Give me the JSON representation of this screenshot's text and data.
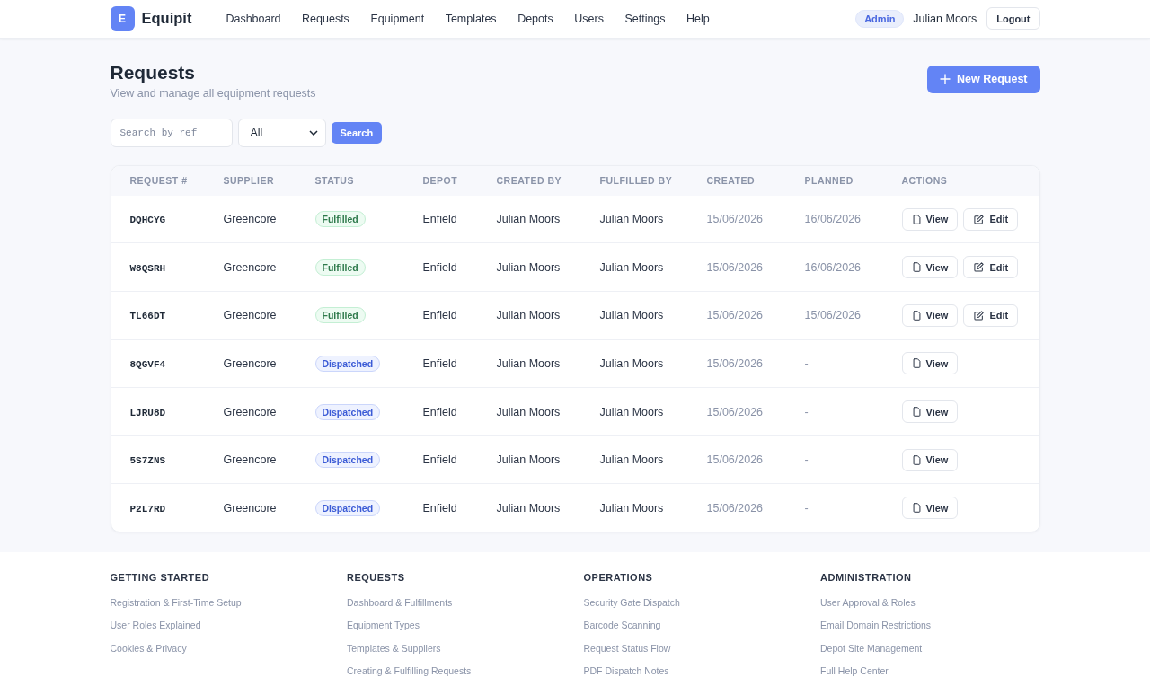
{
  "header": {
    "logo": {
      "mark": "E",
      "name": "Equipit"
    },
    "nav": [
      "Dashboard",
      "Requests",
      "Equipment",
      "Templates",
      "Depots",
      "Users",
      "Settings",
      "Help"
    ],
    "role_badge": "Admin",
    "user_name": "Julian Moors",
    "logout": "Logout"
  },
  "page": {
    "title": "Requests",
    "subtitle": "View and manage all equipment requests",
    "new_button": "New Request"
  },
  "filters": {
    "search": {
      "placeholder": "Search by ref"
    },
    "status_select": {
      "value": "All"
    },
    "search_button": "Search"
  },
  "table": {
    "columns": [
      "REQUEST #",
      "SUPPLIER",
      "STATUS",
      "DEPOT",
      "CREATED BY",
      "FULFILLED BY",
      "CREATED",
      "PLANNED",
      "ACTIONS"
    ],
    "rows": [
      {
        "ref": "DQHCYG",
        "supplier": "Greencore",
        "status": {
          "label": "Fulfilled",
          "kind": "fulfilled"
        },
        "depot": "Enfield",
        "created_by": "Julian Moors",
        "fulfilled_by": "Julian Moors",
        "created": "15/06/2026",
        "planned": "16/06/2026",
        "actions": [
          {
            "kind": "view",
            "label": "View"
          },
          {
            "kind": "edit",
            "label": "Edit"
          }
        ]
      },
      {
        "ref": "W8QSRH",
        "supplier": "Greencore",
        "status": {
          "label": "Fulfilled",
          "kind": "fulfilled"
        },
        "depot": "Enfield",
        "created_by": "Julian Moors",
        "fulfilled_by": "Julian Moors",
        "created": "15/06/2026",
        "planned": "16/06/2026",
        "actions": [
          {
            "kind": "view",
            "label": "View"
          },
          {
            "kind": "edit",
            "label": "Edit"
          }
        ]
      },
      {
        "ref": "TL66DT",
        "supplier": "Greencore",
        "status": {
          "label": "Fulfilled",
          "kind": "fulfilled"
        },
        "depot": "Enfield",
        "created_by": "Julian Moors",
        "fulfilled_by": "Julian Moors",
        "created": "15/06/2026",
        "planned": "15/06/2026",
        "actions": [
          {
            "kind": "view",
            "label": "View"
          },
          {
            "kind": "edit",
            "label": "Edit"
          }
        ]
      },
      {
        "ref": "8QGVF4",
        "supplier": "Greencore",
        "status": {
          "label": "Dispatched",
          "kind": "dispatched"
        },
        "depot": "Enfield",
        "created_by": "Julian Moors",
        "fulfilled_by": "Julian Moors",
        "created": "15/06/2026",
        "planned": "-",
        "actions": [
          {
            "kind": "view",
            "label": "View"
          }
        ]
      },
      {
        "ref": "LJRU8D",
        "supplier": "Greencore",
        "status": {
          "label": "Dispatched",
          "kind": "dispatched"
        },
        "depot": "Enfield",
        "created_by": "Julian Moors",
        "fulfilled_by": "Julian Moors",
        "created": "15/06/2026",
        "planned": "-",
        "actions": [
          {
            "kind": "view",
            "label": "View"
          }
        ]
      },
      {
        "ref": "5S7ZNS",
        "supplier": "Greencore",
        "status": {
          "label": "Dispatched",
          "kind": "dispatched"
        },
        "depot": "Enfield",
        "created_by": "Julian Moors",
        "fulfilled_by": "Julian Moors",
        "created": "15/06/2026",
        "planned": "-",
        "actions": [
          {
            "kind": "view",
            "label": "View"
          }
        ]
      },
      {
        "ref": "P2L7RD",
        "supplier": "Greencore",
        "status": {
          "label": "Dispatched",
          "kind": "dispatched"
        },
        "depot": "Enfield",
        "created_by": "Julian Moors",
        "fulfilled_by": "Julian Moors",
        "created": "15/06/2026",
        "planned": "-",
        "actions": [
          {
            "kind": "view",
            "label": "View"
          }
        ]
      }
    ]
  },
  "footer": {
    "sections": [
      {
        "heading": "GETTING STARTED",
        "links": [
          "Registration & First-Time Setup",
          "User Roles Explained",
          "Cookies & Privacy"
        ]
      },
      {
        "heading": "REQUESTS",
        "links": [
          "Dashboard & Fulfillments",
          "Equipment Types",
          "Templates & Suppliers",
          "Creating & Fulfilling Requests"
        ]
      },
      {
        "heading": "OPERATIONS",
        "links": [
          "Security Gate Dispatch",
          "Barcode Scanning",
          "Request Status Flow",
          "PDF Dispatch Notes"
        ]
      },
      {
        "heading": "ADMINISTRATION",
        "links": [
          "User Approval & Roles",
          "Email Domain Restrictions",
          "Depot Site Management",
          "Full Help Center"
        ]
      }
    ]
  }
}
